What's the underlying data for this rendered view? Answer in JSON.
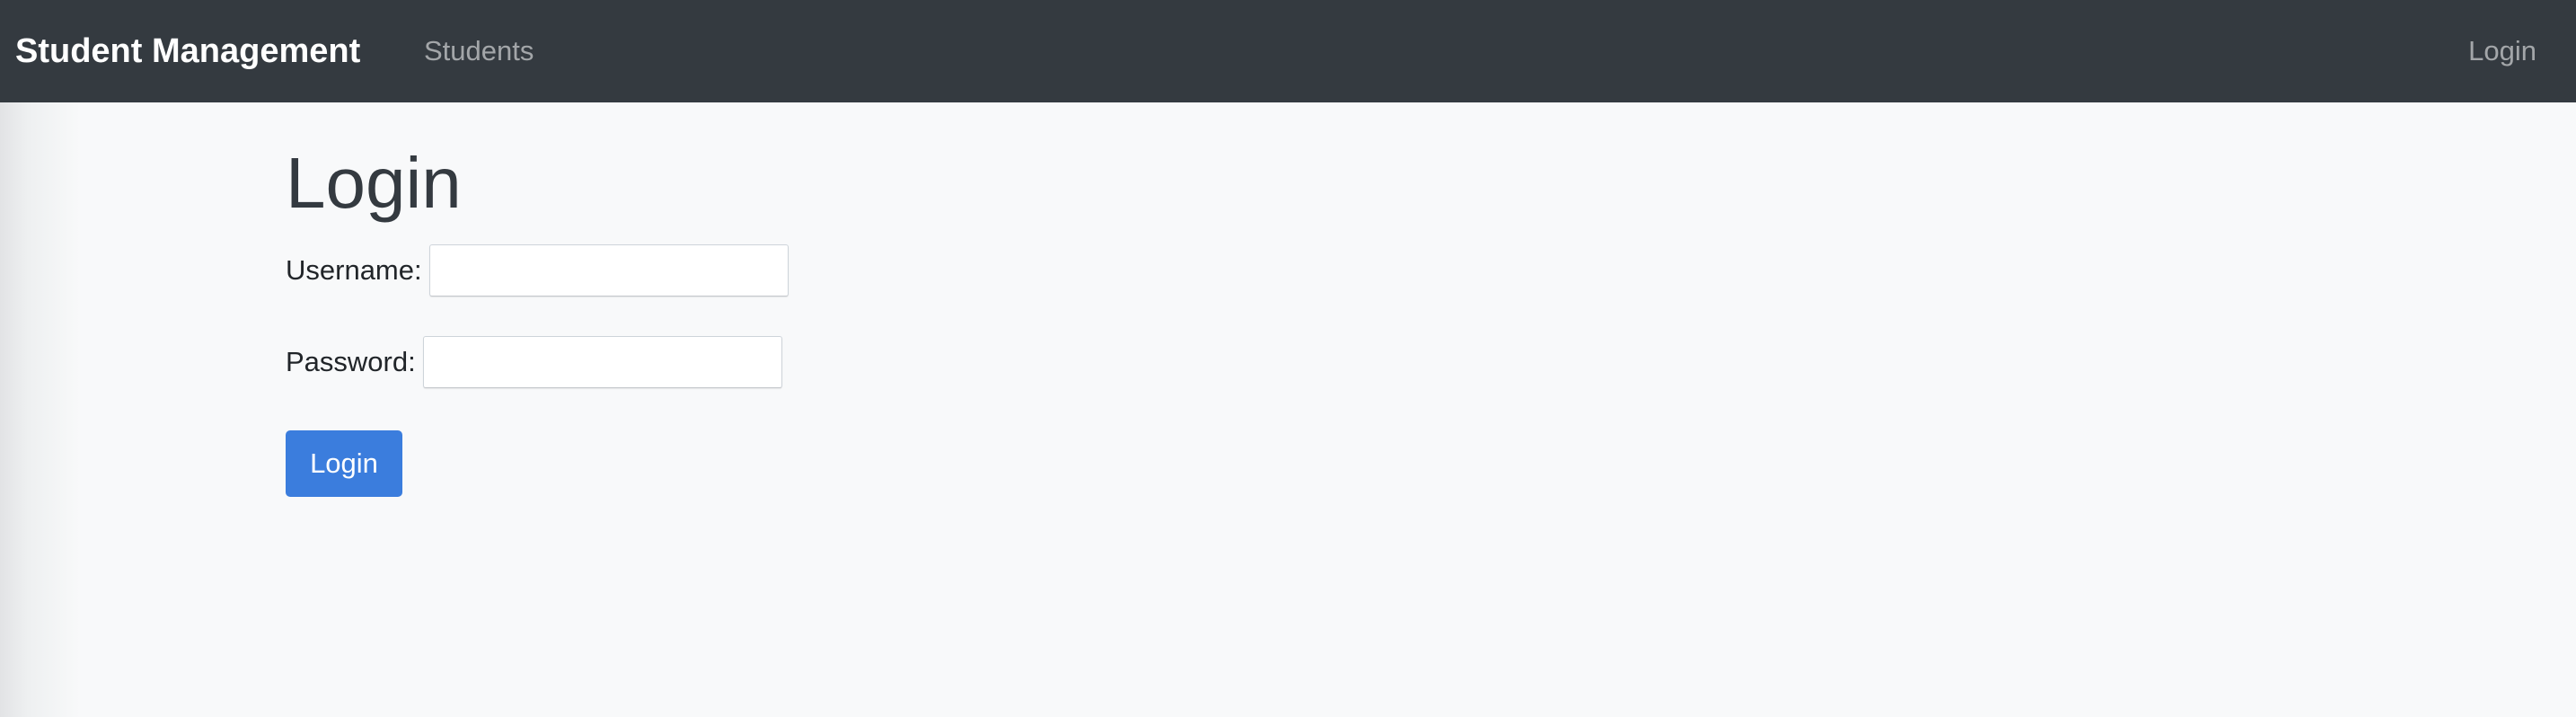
{
  "navbar": {
    "brand": "Student Management",
    "links": [
      {
        "label": "Students"
      }
    ],
    "right_link": "Login"
  },
  "main": {
    "title": "Login",
    "form": {
      "username_label": "Username:",
      "username_value": "",
      "password_label": "Password:",
      "password_value": "",
      "submit_label": "Login"
    }
  },
  "colors": {
    "navbar_bg": "#343a40",
    "page_bg": "#f8f9fa",
    "primary_button": "#3b7ddd"
  }
}
